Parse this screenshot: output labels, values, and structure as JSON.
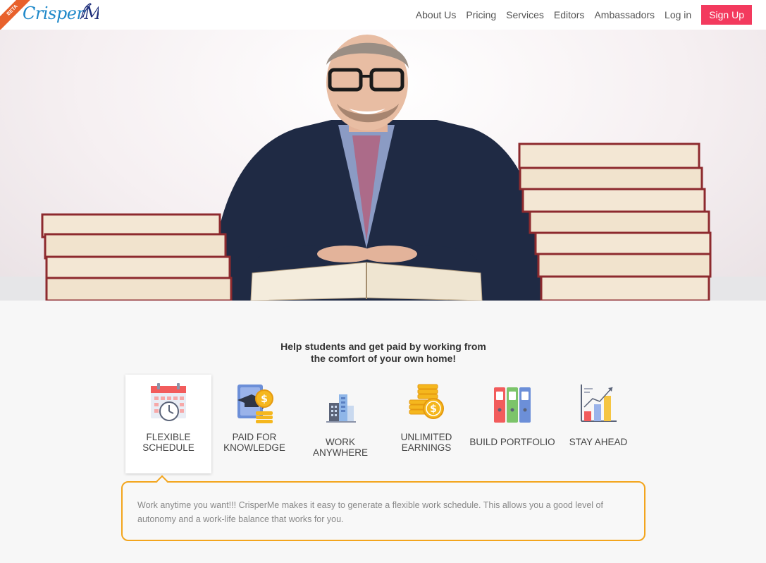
{
  "brand": {
    "name_part1": "Crisper",
    "name_part2": "Me",
    "badge": "BETA"
  },
  "nav": {
    "items": [
      {
        "label": "About Us"
      },
      {
        "label": "Pricing"
      },
      {
        "label": "Services"
      },
      {
        "label": "Editors"
      },
      {
        "label": "Ambassadors"
      },
      {
        "label": "Log in"
      }
    ],
    "signup_label": "Sign Up"
  },
  "tagline": {
    "line1": "Help students and get paid by working from",
    "line2": "the comfort of your own home!"
  },
  "features": [
    {
      "line1": "FLEXIBLE",
      "line2": "SCHEDULE",
      "icon": "calendar-clock-icon",
      "active": true
    },
    {
      "line1": "PAID FOR",
      "line2": "KNOWLEDGE",
      "icon": "graduation-cap-coin-icon"
    },
    {
      "line1": "WORK ANYWHERE",
      "icon": "city-buildings-icon"
    },
    {
      "line1": "UNLIMITED",
      "line2": "EARNINGS",
      "icon": "coin-stack-icon"
    },
    {
      "line1": "BUILD PORTFOLIO",
      "icon": "binders-icon"
    },
    {
      "line1": "STAY AHEAD",
      "icon": "growth-chart-icon"
    }
  ],
  "description": {
    "text": "Work anytime you want!!! CrisperMe makes it easy to generate a flexible work schedule. This allows you a good level of autonomy and a work-life balance that works for you."
  },
  "colors": {
    "accent": "#f33a5e",
    "highlight_border": "#f3a51d",
    "logo_blue": "#1e88c9"
  }
}
